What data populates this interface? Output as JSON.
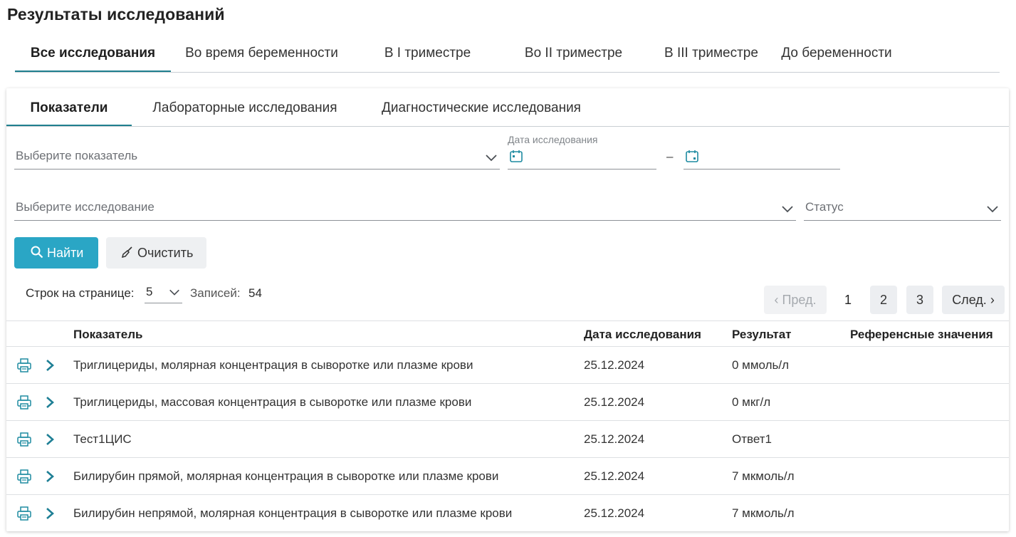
{
  "page": {
    "title": "Результаты исследований"
  },
  "top_tabs": [
    {
      "label": "Все исследования",
      "active": true
    },
    {
      "label": "Во время беременности",
      "active": false
    },
    {
      "label": "В I триместре",
      "active": false
    },
    {
      "label": "Во II триместре",
      "active": false
    },
    {
      "label": "В III триместре",
      "active": false
    },
    {
      "label": "До беременности",
      "active": false
    }
  ],
  "sub_tabs": [
    {
      "label": "Показатели",
      "active": true
    },
    {
      "label": "Лабораторные исследования",
      "active": false
    },
    {
      "label": "Диагностические исследования",
      "active": false
    }
  ],
  "filters": {
    "indicator_placeholder": "Выберите показатель",
    "date_label": "Дата исследования",
    "date_from": "",
    "date_to": "",
    "date_separator": "–",
    "study_placeholder": "Выберите исследование",
    "status_placeholder": "Статус"
  },
  "buttons": {
    "find": "Найти",
    "clear": "Очистить"
  },
  "pagination": {
    "rows_label": "Строк на странице:",
    "rows_value": "5",
    "records_label": "Записей:",
    "records_count": "54",
    "prev": "Пред.",
    "next": "След.",
    "pages": [
      "1",
      "2",
      "3"
    ],
    "current_page": "1"
  },
  "table": {
    "headers": {
      "indicator": "Показатель",
      "date": "Дата исследования",
      "result": "Результат",
      "reference": "Референсные значения"
    },
    "rows": [
      {
        "indicator": "Триглицериды, молярная концентрация в сыворотке или плазме крови",
        "date": "25.12.2024",
        "result": "0 ммоль/л",
        "reference": ""
      },
      {
        "indicator": "Триглицериды, массовая концентрация в сыворотке или плазме крови",
        "date": "25.12.2024",
        "result": "0 мкг/л",
        "reference": ""
      },
      {
        "indicator": "Тест1ЦИС",
        "date": "25.12.2024",
        "result": "Ответ1",
        "reference": ""
      },
      {
        "indicator": "Билирубин прямой, молярная концентрация в сыворотке или плазме крови",
        "date": "25.12.2024",
        "result": "7 мкмоль/л",
        "reference": ""
      },
      {
        "indicator": "Билирубин непрямой, молярная концентрация в сыворотке или плазме крови",
        "date": "25.12.2024",
        "result": "7 мкмоль/л",
        "reference": ""
      }
    ]
  },
  "colors": {
    "accent": "#1f7f8e",
    "primary_button": "#2aa6c5",
    "icon_teal": "#1e8ba1"
  },
  "icons": {
    "chevron": "chevron-down-icon",
    "calendar": "calendar-icon",
    "search": "search-icon",
    "clear": "broom-icon",
    "print": "printer-icon",
    "expand": "chevron-right-icon"
  }
}
